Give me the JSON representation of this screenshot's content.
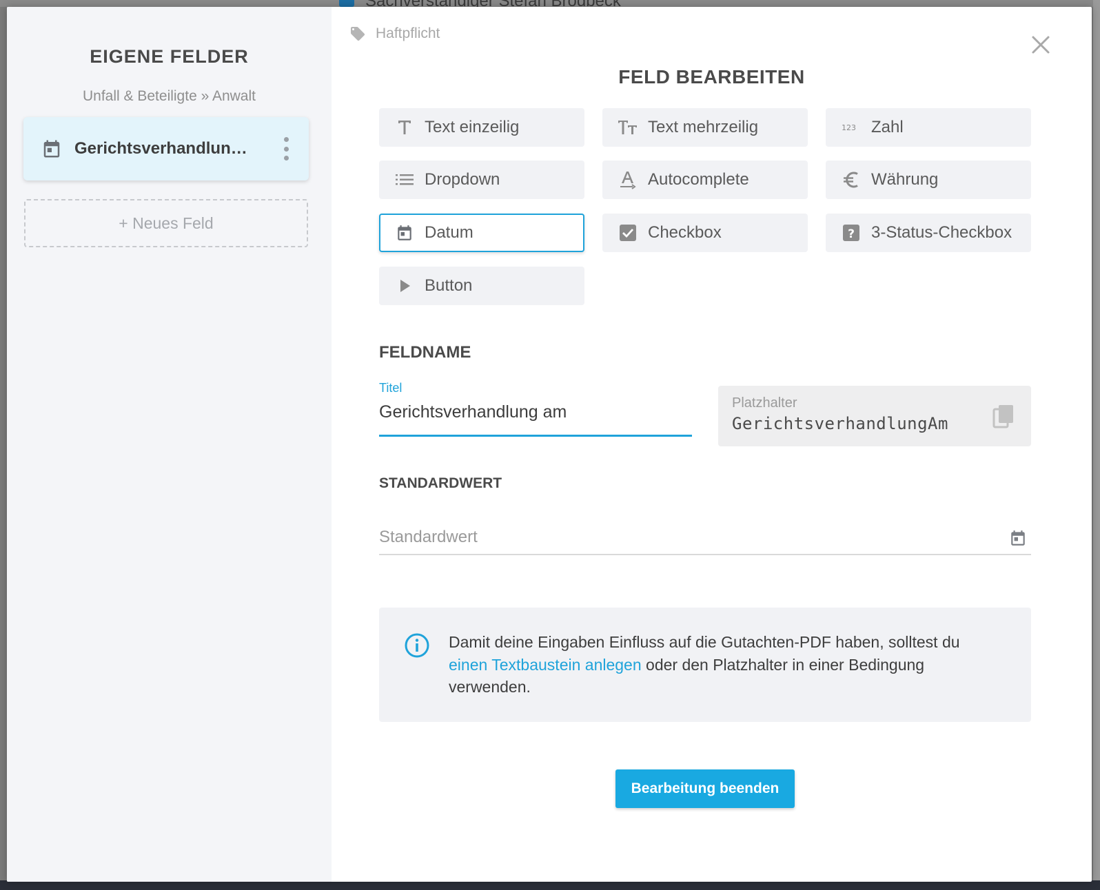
{
  "background": {
    "top_text": "Sachverständiger Stefan Brodbeck"
  },
  "sidebar": {
    "title": "EIGENE FELDER",
    "breadcrumb": "Unfall & Beteiligte » Anwalt",
    "field_card_label": "Gerichtsverhandlun…",
    "new_field_label": "+ Neues Feld"
  },
  "main": {
    "tag_label": "Haftpflicht",
    "title": "FELD BEARBEITEN",
    "types": [
      {
        "label": "Text einzeilig",
        "icon": "text-icon"
      },
      {
        "label": "Text mehrzeilig",
        "icon": "text-multiline-icon"
      },
      {
        "label": "Zahl",
        "icon": "number-icon"
      },
      {
        "label": "Dropdown",
        "icon": "list-icon"
      },
      {
        "label": "Autocomplete",
        "icon": "autocomplete-icon"
      },
      {
        "label": "Währung",
        "icon": "euro-icon"
      },
      {
        "label": "Datum",
        "icon": "calendar-icon",
        "selected": true
      },
      {
        "label": "Checkbox",
        "icon": "checkbox-icon"
      },
      {
        "label": "3-Status-Checkbox",
        "icon": "question-checkbox-icon"
      },
      {
        "label": "Button",
        "icon": "play-icon"
      }
    ],
    "fieldname_heading": "FELDNAME",
    "title_field_label": "Titel",
    "title_field_value": "Gerichtsverhandlung am",
    "placeholder_label": "Platzhalter",
    "placeholder_value": "GerichtsverhandlungAm",
    "default_heading": "STANDARDWERT",
    "default_placeholder": "Standardwert",
    "info_text_before": "Damit deine Eingaben Einfluss auf die Gutachten-PDF haben, solltest du ",
    "info_link": "einen Textbaustein anlegen",
    "info_text_after": " oder den Platzhalter in einer Bedingung verwenden.",
    "finish_button": "Bearbeitung beenden"
  },
  "colors": {
    "accent": "#1fa3da",
    "button": "#19a9e1",
    "sidebar_bg": "#f4f5f8",
    "selected_card_bg": "#e3f4fb"
  }
}
